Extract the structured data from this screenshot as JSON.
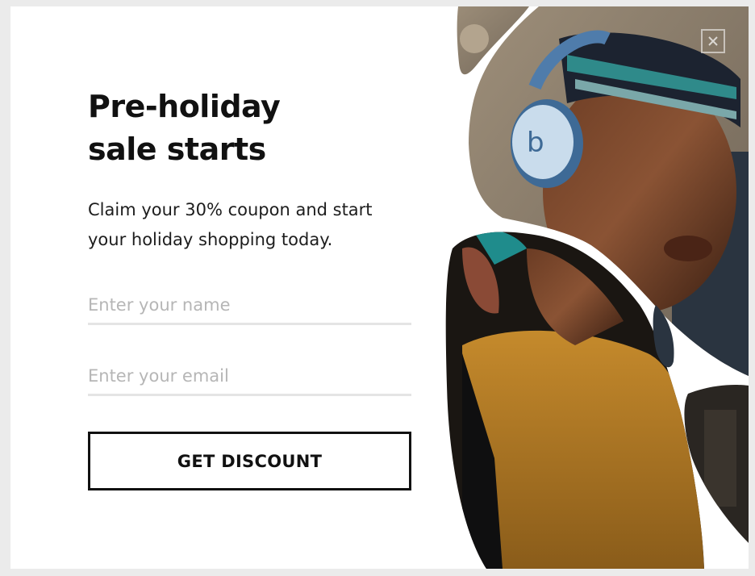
{
  "popup": {
    "headline_line1": "Pre-holiday",
    "headline_line2": "sale starts",
    "subtext_line1": "Claim your 30% coupon and start",
    "subtext_line2": "your holiday shopping today.",
    "name_placeholder": "Enter your name",
    "email_placeholder": "Enter your email",
    "cta_label": "GET DISCOUNT",
    "photo_subject": "person-with-headphones-photo",
    "close_icon": "close-icon"
  },
  "colors": {
    "text": "#111111",
    "placeholder": "#b6b6b6",
    "underline": "#e4e4e4",
    "background": "#ffffff"
  }
}
